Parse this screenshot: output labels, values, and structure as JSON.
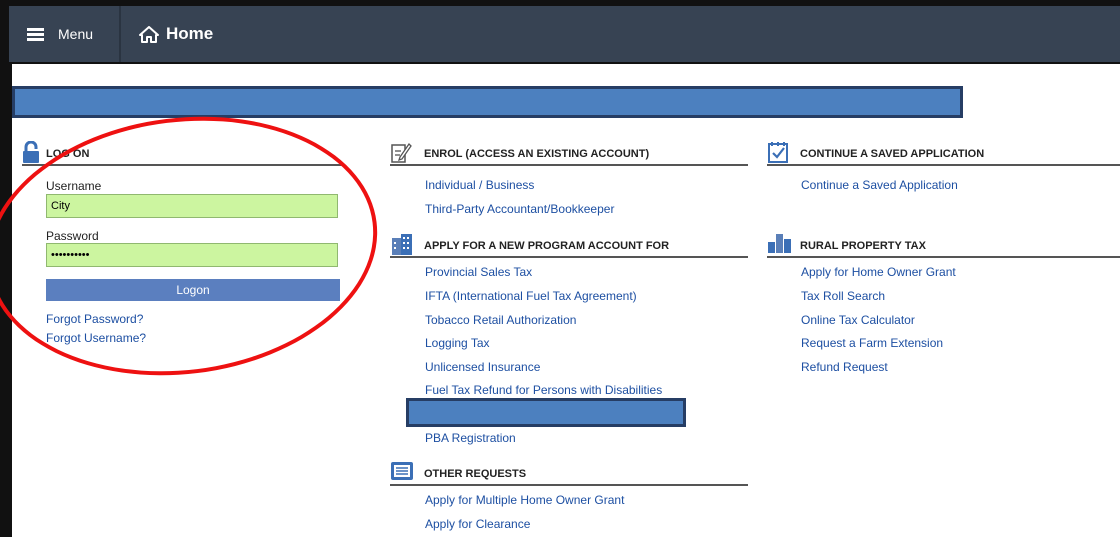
{
  "nav": {
    "menu_label": "Menu",
    "home_label": "Home"
  },
  "logon": {
    "title": "LOG ON",
    "username_label": "Username",
    "username_value": "City",
    "password_label": "Password",
    "password_value": "••••••••••",
    "button_label": "Logon",
    "forgot_password": "Forgot Password?",
    "forgot_username": "Forgot Username?"
  },
  "enrol": {
    "title": "ENROL (ACCESS AN EXISTING ACCOUNT)",
    "links": [
      "Individual / Business",
      "Third-Party Accountant/Bookkeeper"
    ]
  },
  "apply": {
    "title": "APPLY FOR A NEW PROGRAM ACCOUNT FOR",
    "links": [
      "Provincial Sales Tax",
      "IFTA (International Fuel Tax Agreement)",
      "Tobacco Retail Authorization",
      "Logging Tax",
      "Unlicensed Insurance",
      "Fuel Tax Refund for Persons with Disabilities",
      "PBA Registration"
    ]
  },
  "other": {
    "title": "OTHER REQUESTS",
    "links": [
      "Apply for Multiple Home Owner Grant",
      "Apply for Clearance"
    ]
  },
  "saved": {
    "title": "CONTINUE A SAVED APPLICATION",
    "links": [
      "Continue a Saved Application"
    ]
  },
  "rural": {
    "title": "RURAL PROPERTY TAX",
    "links": [
      "Apply for Home Owner Grant",
      "Tax Roll Search",
      "Online Tax Calculator",
      "Request a Farm Extension",
      "Refund Request"
    ]
  },
  "colors": {
    "nav_bg": "#374353",
    "link": "#1d4fa2",
    "input_bg": "#ccf5a0",
    "button": "#5b7fbf",
    "annotation": "#ee1111"
  }
}
